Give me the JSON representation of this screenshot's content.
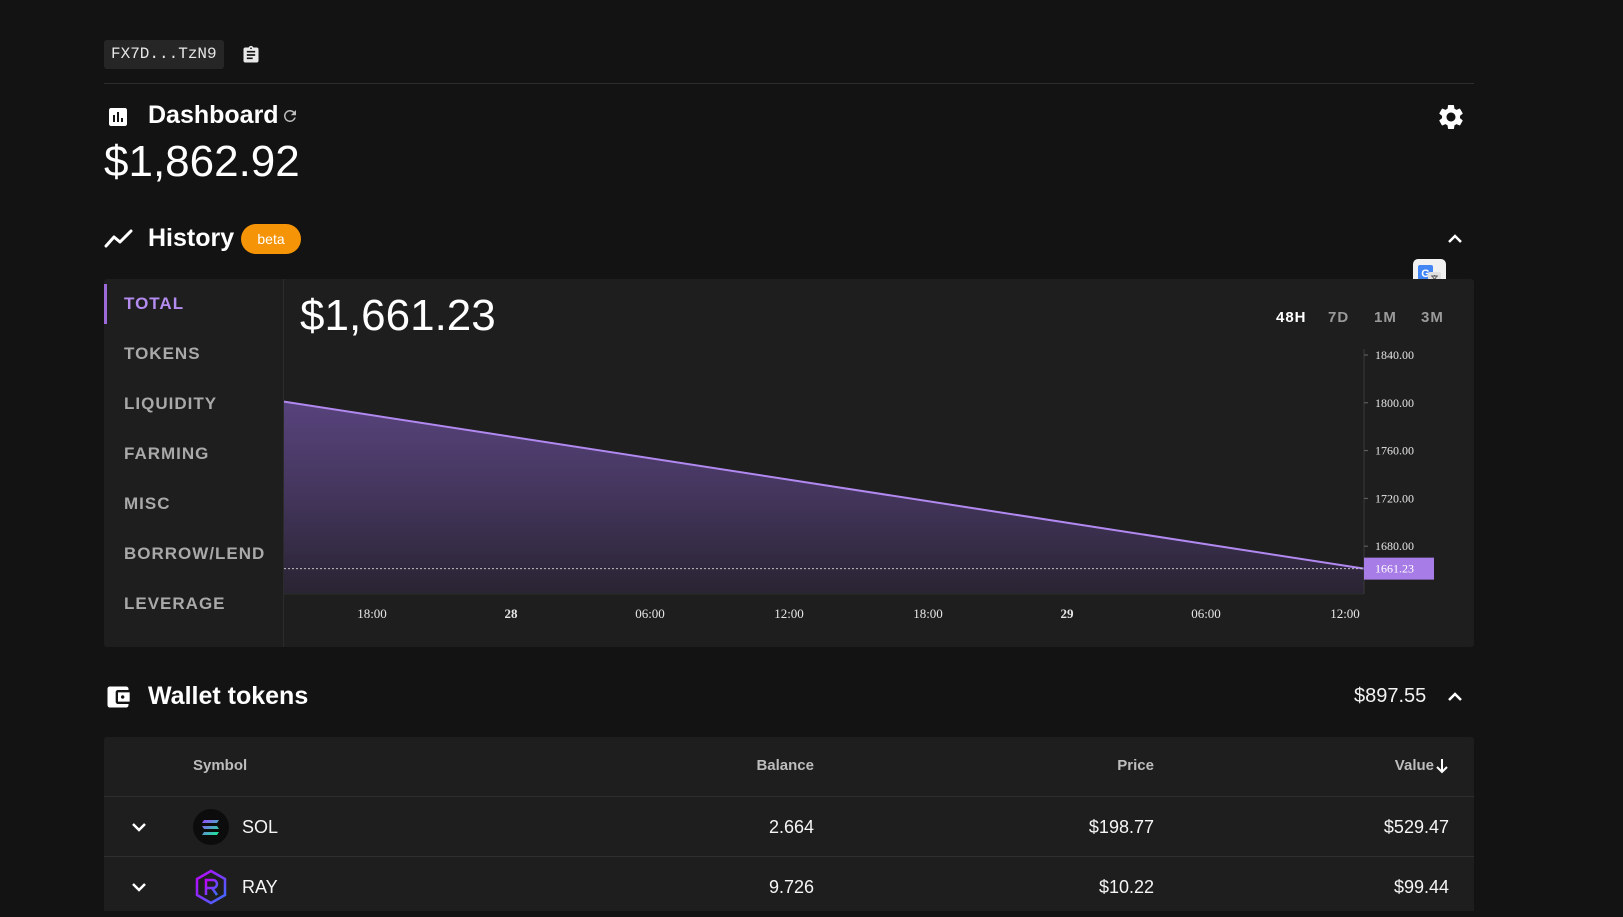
{
  "wallet": {
    "address": "FX7D...TzN9"
  },
  "dashboard": {
    "title": "Dashboard",
    "total_value": "$1,862.92"
  },
  "history": {
    "title": "History",
    "badge": "beta",
    "menu": [
      "TOTAL",
      "TOKENS",
      "LIQUIDITY",
      "FARMING",
      "MISC",
      "BORROW/LEND",
      "LEVERAGE"
    ],
    "selected_menu": "TOTAL",
    "current_value": "$1,661.23",
    "ranges": [
      "48H",
      "7D",
      "1M",
      "3M"
    ],
    "selected_range": "48H"
  },
  "chart_data": {
    "type": "area",
    "x": [
      "start",
      "end"
    ],
    "values": [
      1801,
      1661.23
    ],
    "x_tick_labels": [
      "18:00",
      "28",
      "06:00",
      "12:00",
      "18:00",
      "29",
      "06:00",
      "12:00"
    ],
    "bold_x_ticks": [
      "28",
      "29"
    ],
    "y_tick_labels": [
      "1840.00",
      "1800.00",
      "1760.00",
      "1720.00",
      "1680.00"
    ],
    "y_ticks": [
      1840,
      1800,
      1760,
      1720,
      1680
    ],
    "current_label": "1661.23",
    "ylim": [
      1640,
      1845
    ],
    "color": "#b189f0"
  },
  "wallet_tokens": {
    "title": "Wallet tokens",
    "total": "$897.55",
    "columns": {
      "symbol": "Symbol",
      "balance": "Balance",
      "price": "Price",
      "value": "Value"
    },
    "rows": [
      {
        "symbol": "SOL",
        "balance": "2.664",
        "price": "$198.77",
        "value": "$529.47"
      },
      {
        "symbol": "RAY",
        "balance": "9.726",
        "price": "$10.22",
        "value": "$99.44"
      }
    ]
  },
  "colors": {
    "accent": "#b189f0",
    "badge": "#f59406",
    "background": "#131313",
    "panel": "#1e1e1e"
  }
}
